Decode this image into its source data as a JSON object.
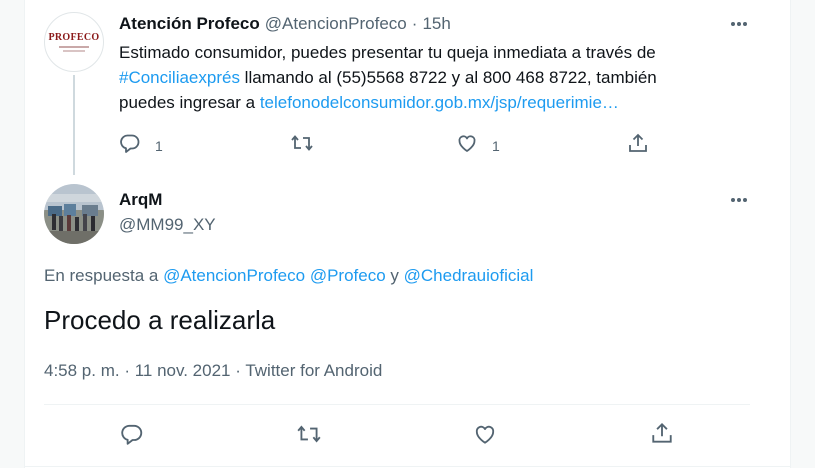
{
  "parent_tweet": {
    "avatar_logo_text": "PROFECO",
    "display_name": "Atención Profeco",
    "handle": "@AtencionProfeco",
    "separator": "·",
    "time": "15h",
    "body": {
      "line1": "Estimado consumidor, puedes presentar tu queja inmediata a través de",
      "hashtag": "#Conciliaexprés",
      "line2_rest": " llamando al (55)5568 8722 y al 800 468 8722, también",
      "line3_prefix": "puedes ingresar a ",
      "url": "telefonodelconsumidor.gob.mx/jsp/requerimie…"
    },
    "reply_count": "1",
    "like_count": "1",
    "icons": {
      "more": "more-horizontal-icon",
      "reply": "reply-icon",
      "retweet": "retweet-icon",
      "like": "like-icon",
      "share": "share-icon"
    }
  },
  "main_tweet": {
    "display_name": "ArqM",
    "handle": "@MM99_XY",
    "reply_prefix": "En respuesta a ",
    "mention1": "@AtencionProfeco",
    "mention2": "@Profeco",
    "reply_join": " y ",
    "mention3": "@Chedrauioficial",
    "text": "Procedo a realizarla",
    "timestamp": "4:58 p. m. · 11 nov. 2021",
    "meta_sep": " · ",
    "source": "Twitter for Android"
  },
  "colors": {
    "link": "#1d9bf0",
    "secondary_text": "#536471",
    "primary_text": "#0f1419",
    "divider": "#eff3f4",
    "thread_line": "#cfd9de"
  }
}
